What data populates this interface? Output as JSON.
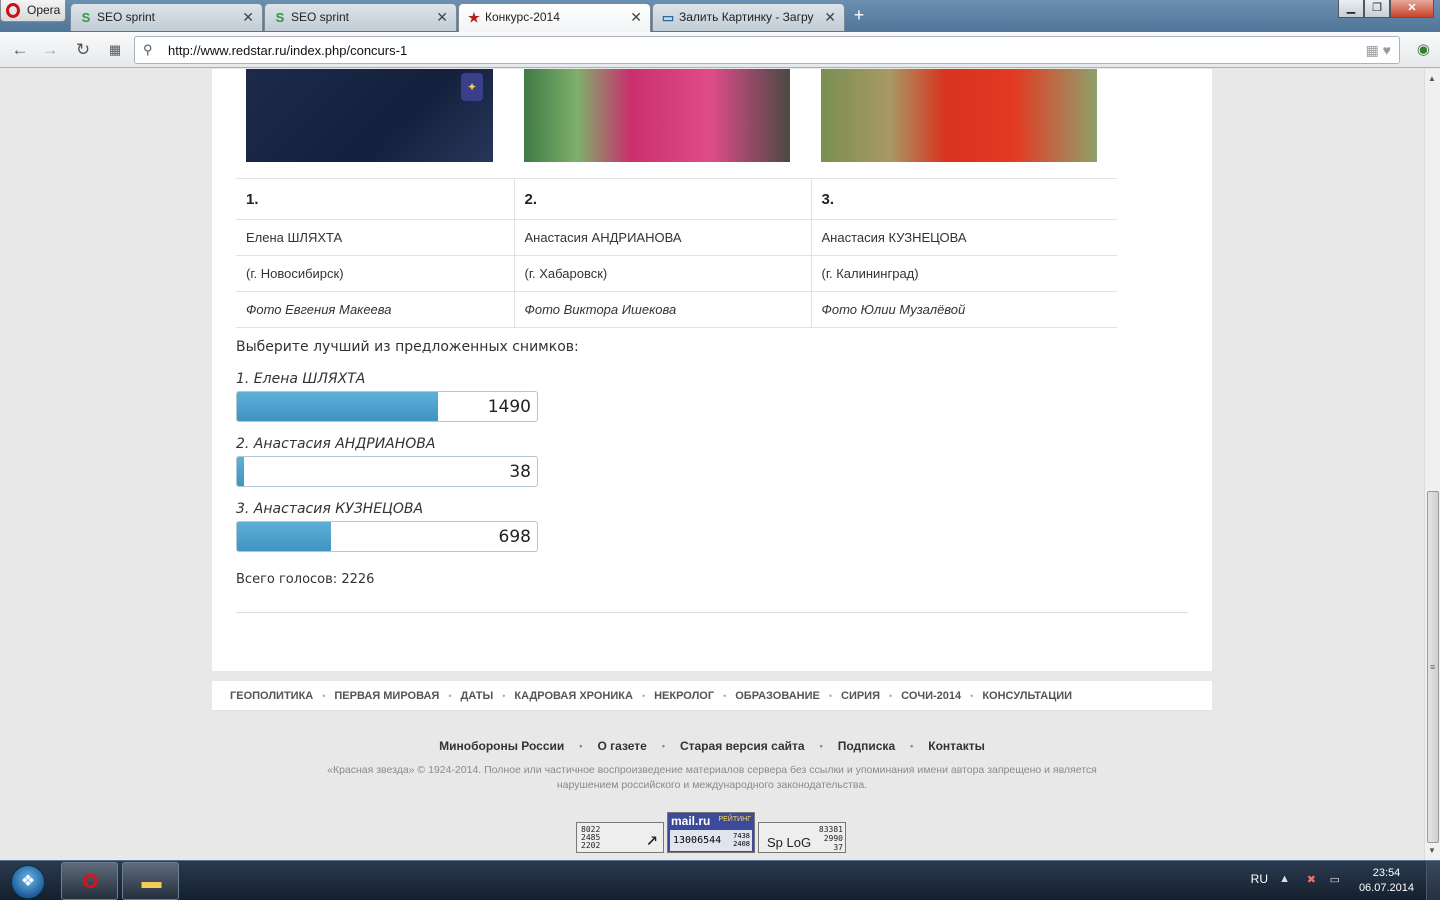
{
  "browser": {
    "menu_label": "Opera",
    "tabs": [
      {
        "label": "SEO sprint",
        "icon": "S",
        "active": false
      },
      {
        "label": "SEO sprint",
        "icon": "S",
        "active": false
      },
      {
        "label": "Конкурс-2014",
        "icon": "★",
        "active": true
      },
      {
        "label": "Залить Картинку - Загру",
        "icon": "▭",
        "active": false
      }
    ],
    "url": "http://www.redstar.ru/index.php/concurs-1"
  },
  "contest": {
    "candidates": [
      {
        "number": "1.",
        "name": "Елена ШЛЯХТА",
        "city": "(г. Новосибирск)",
        "photo_credit": "Фото Евгения Макеева"
      },
      {
        "number": "2.",
        "name": "Анастасия АНДРИАНОВА",
        "city": "(г. Хабаровск)",
        "photo_credit": "Фото Виктора Ишекова"
      },
      {
        "number": "3.",
        "name": "Анастасия КУЗНЕЦОВА",
        "city": "(г. Калининград)",
        "photo_credit": "Фото Юлии Музалёвой"
      }
    ]
  },
  "poll": {
    "question": "Выберите лучший из предложенных снимков:",
    "options": [
      {
        "label": "1. Елена ШЛЯХТА",
        "votes": "1490",
        "share": 0.67
      },
      {
        "label": "2. Анастасия АНДРИАНОВА",
        "votes": "38",
        "share": 0.017
      },
      {
        "label": "3. Анастасия КУЗНЕЦОВА",
        "votes": "698",
        "share": 0.314
      }
    ],
    "total_label": "Всего голосов:",
    "total_value": "2226"
  },
  "categories": [
    "ГЕОПОЛИТИКА",
    "ПЕРВАЯ МИРОВАЯ",
    "ДАТЫ",
    "КАДРОВАЯ ХРОНИКА",
    "НЕКРОЛОГ",
    "ОБРАЗОВАНИЕ",
    "СИРИЯ",
    "СОЧИ-2014",
    "КОНСУЛЬТАЦИИ"
  ],
  "footer": {
    "links": [
      "Минобороны России",
      "О газете",
      "Старая версия сайта",
      "Подписка",
      "Контакты"
    ],
    "copyright": "«Красная звезда» © 1924-2014. Полное или частичное воспроизведение материалов сервера без ссылки и упоминания имени автора запрещено и является нарушением российского и международного законодательства.",
    "counter_a": [
      "8022",
      "2485",
      "2202"
    ],
    "mailru": {
      "brand": "mail.ru",
      "tag": "РЕЙТИНГ",
      "value": "13006544",
      "small": [
        "7438",
        "2408"
      ]
    },
    "spylog": {
      "brand": "Sp LoG",
      "small": [
        "83381",
        "2990",
        "37"
      ]
    }
  },
  "taskbar": {
    "lang": "RU",
    "time": "23:54",
    "date": "06.07.2014"
  }
}
